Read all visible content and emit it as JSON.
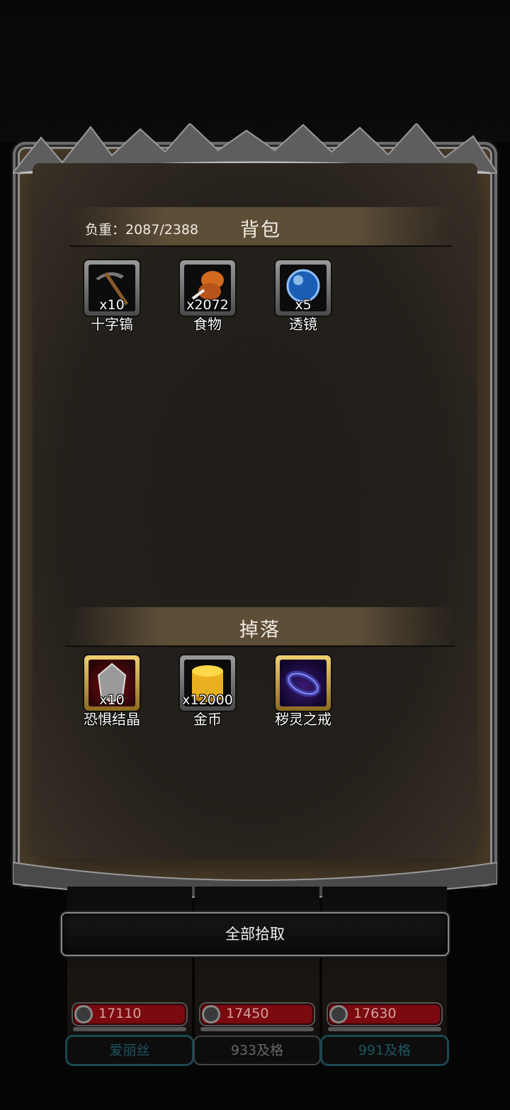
{
  "backpack": {
    "title": "背包",
    "load_label": "负重：2087/2388",
    "items": [
      {
        "name": "十字镐",
        "count": "x10",
        "icon": "pickaxe-icon"
      },
      {
        "name": "食物",
        "count": "x2072",
        "icon": "meat-icon"
      },
      {
        "name": "透镜",
        "count": "x5",
        "icon": "lens-icon"
      }
    ]
  },
  "drops": {
    "title": "掉落",
    "items": [
      {
        "name": "恐惧结晶",
        "count": "x10",
        "icon": "crystal-icon"
      },
      {
        "name": "金币",
        "count": "x12000",
        "icon": "gold-coin-icon"
      },
      {
        "name": "秽灵之戒",
        "count": "",
        "icon": "ring-icon"
      }
    ]
  },
  "actions": {
    "pick_all": "全部拾取"
  },
  "heroes": [
    {
      "power": "17110",
      "label": "爱丽丝"
    },
    {
      "power": "17450",
      "label": "933及格"
    },
    {
      "power": "17630",
      "label": "991及格"
    }
  ]
}
